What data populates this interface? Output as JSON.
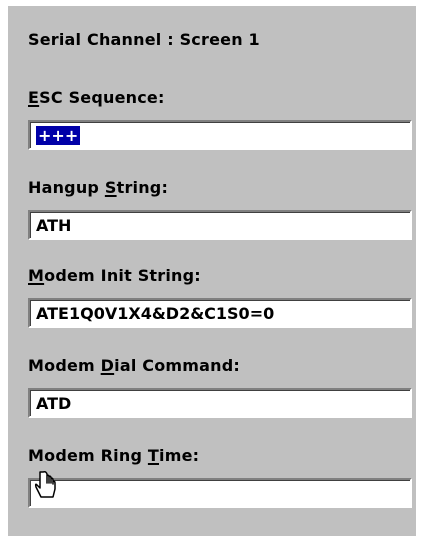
{
  "screen": {
    "title": "Serial Channel : Screen 1"
  },
  "fields": [
    {
      "label_underline": "E",
      "label_rest": "SC Sequence:",
      "value": "+++",
      "selected": true
    },
    {
      "label_pre": "Hangup ",
      "label_underline": "S",
      "label_rest": "tring:",
      "value": "ATH"
    },
    {
      "label_underline": "M",
      "label_rest": "odem Init String:",
      "value": "ATE1Q0V1X4&D2&C1S0=0"
    },
    {
      "label_pre": "Modem ",
      "label_underline": "D",
      "label_rest": "ial Command:",
      "value": "ATD"
    },
    {
      "label_pre": "Modem Ring ",
      "label_underline": "T",
      "label_rest": "ime:",
      "value": ""
    }
  ]
}
